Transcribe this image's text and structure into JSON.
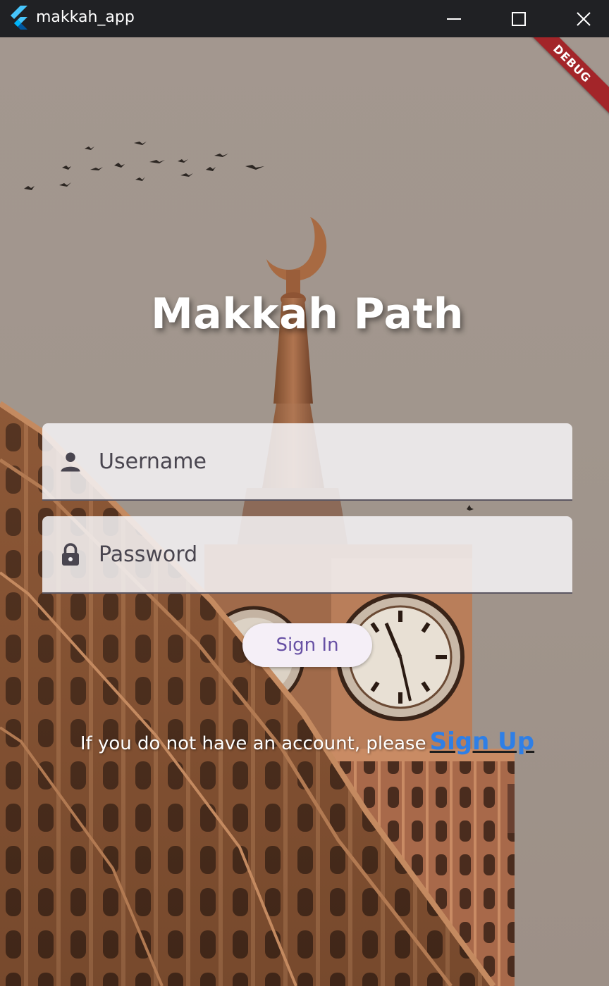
{
  "window": {
    "title": "makkah_app",
    "controls": [
      "minimize",
      "maximize",
      "close"
    ]
  },
  "debug_banner": "DEBUG",
  "heading": "Makkah Path",
  "form": {
    "username": {
      "placeholder": "Username",
      "value": "",
      "icon": "person-icon"
    },
    "password": {
      "placeholder": "Password",
      "value": "",
      "icon": "lock-icon"
    },
    "signin_label": "Sign In"
  },
  "signup": {
    "prompt": "If you do not have an account, please",
    "link_label": "Sign Up"
  },
  "colors": {
    "titlebar": "#202124",
    "debug_banner": "#a32529",
    "button_text": "#6750a4",
    "link": "#2f7fe6"
  }
}
